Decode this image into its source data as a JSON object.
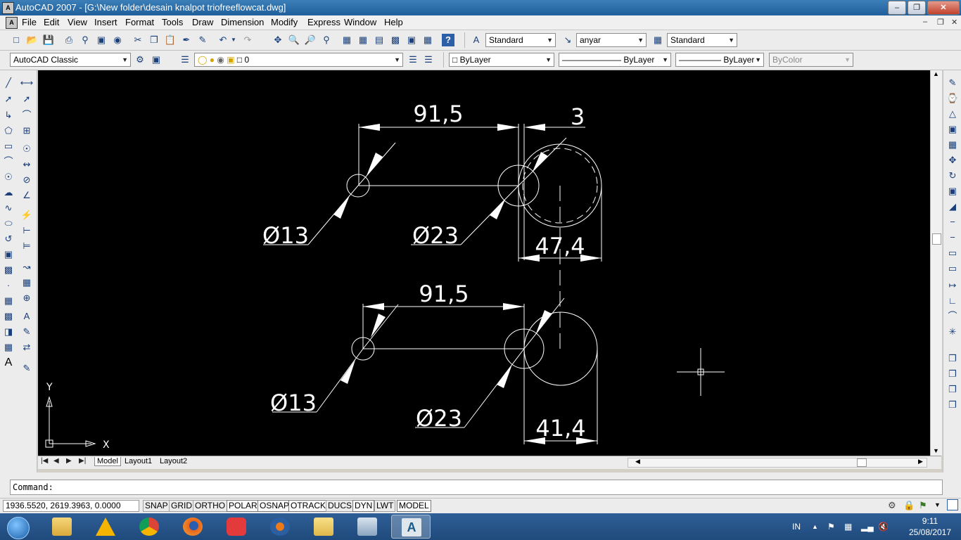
{
  "window": {
    "title": "AutoCAD 2007 - [G:\\New folder\\desain knalpot triofreeflowcat.dwg]",
    "app_icon": "autocad-icon"
  },
  "menu": [
    "File",
    "Edit",
    "View",
    "Insert",
    "Format",
    "Tools",
    "Draw",
    "Dimension",
    "Modify",
    "Express",
    "Window",
    "Help"
  ],
  "toolbar1": {
    "text_style": "Standard",
    "dim_style": "anyar",
    "table_style": "Standard"
  },
  "toolbar2": {
    "workspace": "AutoCAD Classic",
    "layer": "0",
    "color": "ByLayer",
    "linetype": "ByLayer",
    "lineweight": "ByLayer",
    "plotstyle": "ByColor"
  },
  "drawing": {
    "top": {
      "dim_length": "91,5",
      "dim_gap": "3",
      "dia_small": "Ø13",
      "dia_large": "Ø23",
      "dim_width": "47,4"
    },
    "bottom": {
      "dim_length": "91,5",
      "dia_small": "Ø13",
      "dia_large": "Ø23",
      "dim_width": "41,4"
    },
    "ucs_x": "X",
    "ucs_y": "Y"
  },
  "tabs": [
    "Model",
    "Layout1",
    "Layout2"
  ],
  "command": {
    "prompt": "Command:"
  },
  "status": {
    "coords": "1936.5520, 2619.3963, 0.0000",
    "toggles": [
      "SNAP",
      "GRID",
      "ORTHO",
      "POLAR",
      "OSNAP",
      "OTRACK",
      "DUCS",
      "DYN",
      "LWT",
      "MODEL"
    ]
  },
  "taskbar": {
    "lang": "IN",
    "time": "9:11",
    "date": "25/08/2017",
    "apps": [
      "start-orb",
      "file-explorer-icon",
      "vlc-icon",
      "chrome-icon",
      "firefox-icon",
      "paint-icon",
      "media-icon",
      "folder-icon",
      "calculator-icon",
      "autocad-icon"
    ]
  },
  "colors": {
    "titlebar": "#2a6aa8",
    "canvas": "#000000",
    "drawing_lines": "#ffffff",
    "taskbar": "#26528a"
  }
}
